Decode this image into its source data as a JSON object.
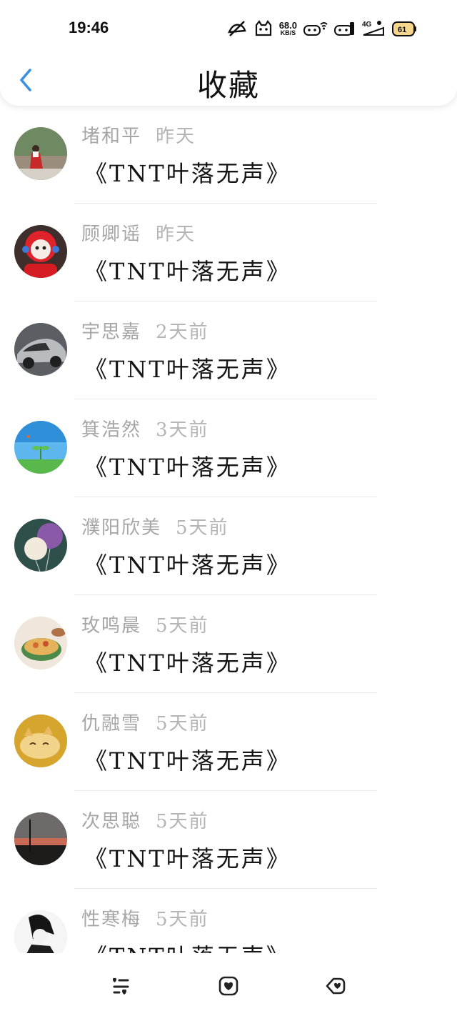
{
  "status_bar": {
    "time": "19:46",
    "net_speed_value": "68.0",
    "net_speed_unit": "KB/S",
    "icons": [
      "dnd-icon",
      "cat-icon",
      "wifi-icon",
      "battery-status-icon",
      "signal-4g-icon",
      "battery-icon"
    ],
    "network_type": "4G"
  },
  "header": {
    "title": "收藏",
    "back_icon": "chevron-left-icon",
    "accent_color": "#3b8fe0"
  },
  "favorites": [
    {
      "name": "堵和平",
      "time": "昨天",
      "song": "《TNT叶落无声》"
    },
    {
      "name": "顾卿谣",
      "time": "昨天",
      "song": "《TNT叶落无声》"
    },
    {
      "name": "宇思嘉",
      "time": "2天前",
      "song": "《TNT叶落无声》"
    },
    {
      "name": "箕浩然",
      "time": "3天前",
      "song": "《TNT叶落无声》"
    },
    {
      "name": "濮阳欣美",
      "time": "5天前",
      "song": "《TNT叶落无声》"
    },
    {
      "name": "玫鸣晨",
      "time": "5天前",
      "song": "《TNT叶落无声》"
    },
    {
      "name": "仇融雪",
      "time": "5天前",
      "song": "《TNT叶落无声》"
    },
    {
      "name": "次思聪",
      "time": "5天前",
      "song": "《TNT叶落无声》"
    },
    {
      "name": "性寒梅",
      "time": "5天前",
      "song": "《TNT叶落无声》"
    }
  ],
  "bottom_nav": {
    "items": [
      "list-heart-icon",
      "heart-box-icon",
      "heart-tag-icon"
    ]
  }
}
